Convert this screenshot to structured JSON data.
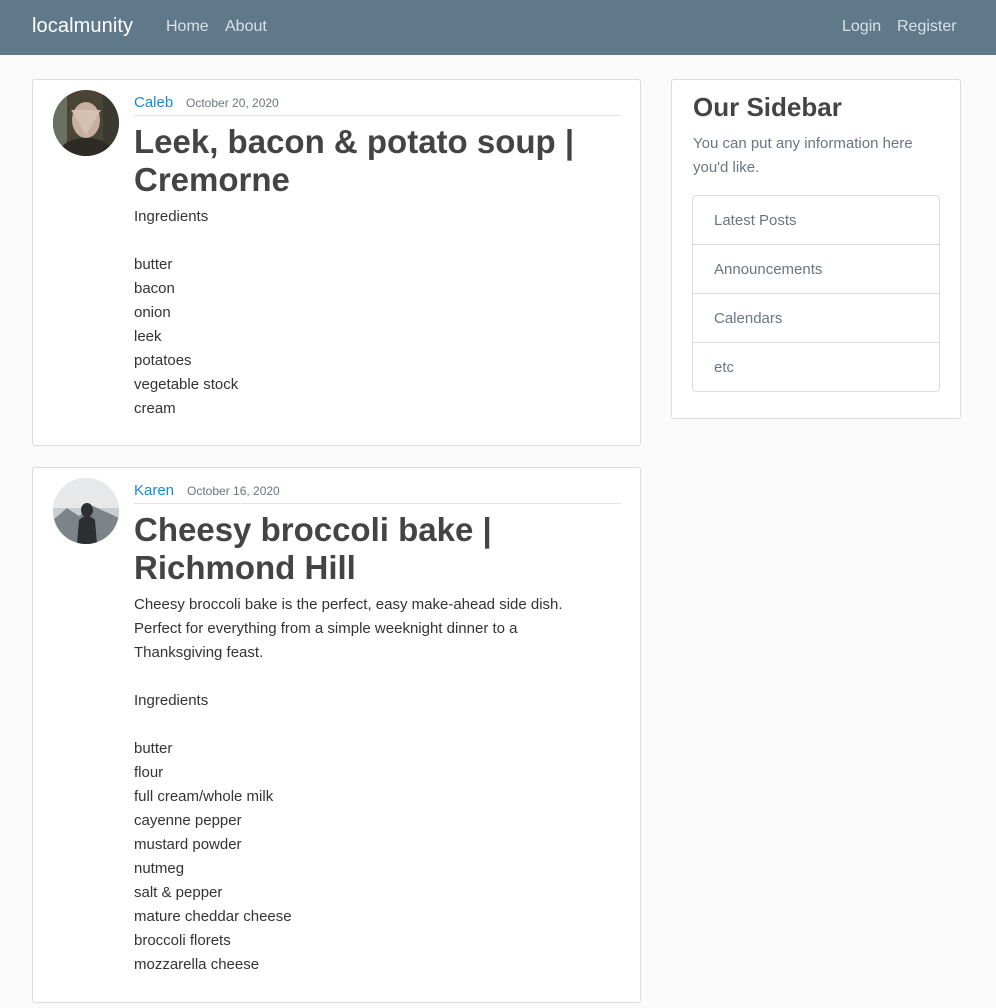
{
  "nav": {
    "brand": "localmunity",
    "home": "Home",
    "about": "About",
    "login": "Login",
    "register": "Register"
  },
  "posts": [
    {
      "author": "Caleb",
      "date": "October 20, 2020",
      "title": "Leek, bacon & potato soup | Cremorne",
      "content": "Ingredients\n\nbutter\nbacon\nonion\nleek\npotatoes\nvegetable stock\ncream"
    },
    {
      "author": "Karen",
      "date": "October 16, 2020",
      "title": "Cheesy broccoli bake | Richmond Hill",
      "content": "Cheesy broccoli bake is the perfect, easy make-ahead side dish. Perfect for everything from a simple weeknight dinner to a Thanksgiving feast.\n\nIngredients\n\nbutter\nflour\nfull cream/whole milk\ncayenne pepper\nmustard powder\nnutmeg\nsalt & pepper\nmature cheddar cheese\nbroccoli florets\nmozzarella cheese"
    }
  ],
  "sidebar": {
    "title": "Our Sidebar",
    "description": "You can put any information here you'd like.",
    "items": [
      {
        "label": "Latest Posts"
      },
      {
        "label": "Announcements"
      },
      {
        "label": "Calendars"
      },
      {
        "label": "etc"
      }
    ]
  },
  "colors": {
    "navbar": "#5f788a",
    "link": "#1e88d6",
    "background": "#fafafa"
  }
}
